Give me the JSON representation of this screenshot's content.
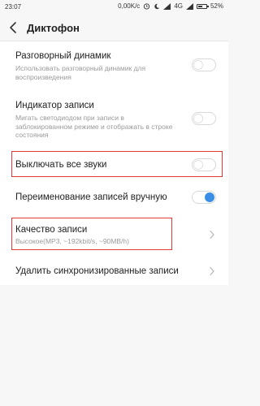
{
  "status_bar": {
    "time": "23:07",
    "net_speed": "0,00K/c",
    "network": "4G",
    "battery": "52%",
    "battery_level": 0.52,
    "icons": [
      "alarm-icon",
      "moon-icon",
      "signal-icon",
      "battery-icon"
    ]
  },
  "header": {
    "title": "Диктофон",
    "back_icon": "chevron-left-icon"
  },
  "settings": [
    {
      "title": "Разговорный динамик",
      "subtitle": "Использовать разговорный динамик для воспроизведения",
      "control": "toggle",
      "checked": false
    },
    {
      "title": "Индикатор записи",
      "subtitle": "Мигать светодиодом при записи в заблокированном режиме и отображать в строке состояния",
      "control": "toggle",
      "checked": false
    },
    {
      "title": "Выключать все звуки",
      "subtitle": "",
      "control": "toggle",
      "checked": false,
      "highlighted": true
    },
    {
      "title": "Переименование записей вручную",
      "subtitle": "",
      "control": "toggle",
      "checked": true
    },
    {
      "title": "Качество записи",
      "subtitle": "Высокое(MP3, ~192kbit/s, ~90MB/h)",
      "control": "chevron",
      "highlighted": true
    },
    {
      "title": "Удалить синхронизированные записи",
      "subtitle": "",
      "control": "chevron"
    }
  ],
  "colors": {
    "accent": "#3a8ee6",
    "highlight_border": "#e53935",
    "background": "#f7f7f7"
  }
}
